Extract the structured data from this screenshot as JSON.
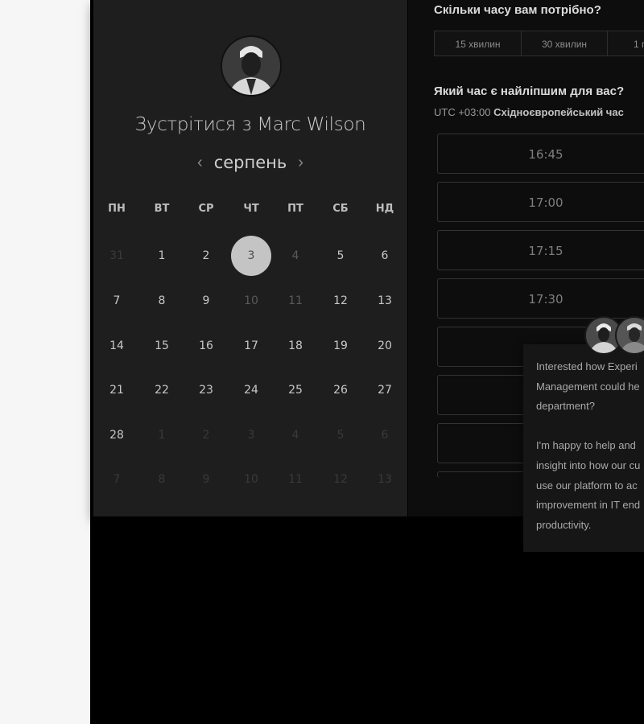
{
  "calendar": {
    "title": "Зустрітися з Marc Wilson",
    "month": "серпень",
    "prev_icon": "chevron-left-icon",
    "next_icon": "chevron-right-icon",
    "weekdays": [
      "ПН",
      "ВТ",
      "СР",
      "ЧТ",
      "ПТ",
      "СБ",
      "НД"
    ],
    "weeks": [
      [
        "31",
        "1",
        "2",
        "3",
        "4",
        "5",
        "6"
      ],
      [
        "7",
        "8",
        "9",
        "10",
        "11",
        "12",
        "13"
      ],
      [
        "14",
        "15",
        "16",
        "17",
        "18",
        "19",
        "20"
      ],
      [
        "21",
        "22",
        "23",
        "24",
        "25",
        "26",
        "27"
      ],
      [
        "28",
        "1",
        "2",
        "3",
        "4",
        "5",
        "6"
      ],
      [
        "7",
        "8",
        "9",
        "10",
        "11",
        "12",
        "13"
      ]
    ],
    "selected_day": "3"
  },
  "booking": {
    "duration_question": "Скільки часу вам потрібно?",
    "durations": [
      "15 хвилин",
      "30 хвилин",
      "1 г"
    ],
    "time_question": "Який час є найліпшим для вас?",
    "timezone_offset": "UTC +03:00",
    "timezone_name": "Східноєвропейський час",
    "slots": [
      "16:45",
      "17:00",
      "17:15",
      "17:30",
      "",
      "",
      "",
      ""
    ]
  },
  "chat_popup": {
    "paragraph1": [
      "Interested how Experi",
      "Management could he",
      "department?"
    ],
    "paragraph2": [
      "I'm happy to help and",
      "insight into how our cu",
      "use our platform to ac",
      "improvement in IT end",
      "productivity."
    ]
  },
  "colors": {
    "page_bg": "#000000",
    "calendar_bg": "#1e1e1e",
    "selected_day_bg": "#c4c4c4",
    "left_strip_bg": "#f6f6f6"
  }
}
